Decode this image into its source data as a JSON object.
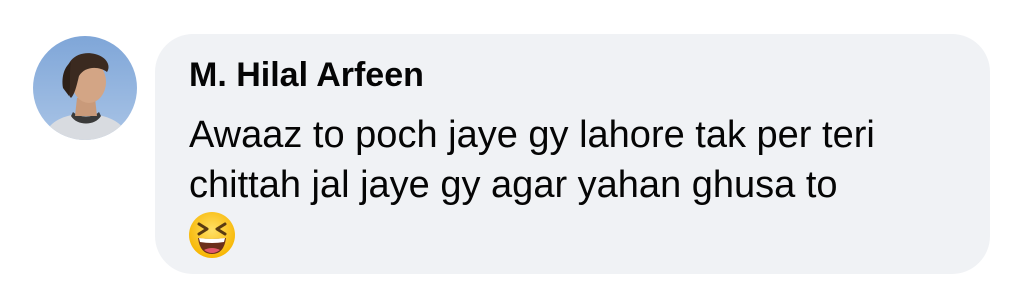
{
  "comment": {
    "author": "M. Hilal Arfeen",
    "text_lines": [
      "Awaaz to poch jaye gy lahore tak per teri",
      "chittah jal jaye gy agar yahan ghusa to"
    ],
    "emoji": "laughing-squinting-face-icon",
    "avatar": "profile-photo"
  },
  "colors": {
    "bubble": "#f0f2f5",
    "text": "#050505",
    "background": "#ffffff"
  }
}
